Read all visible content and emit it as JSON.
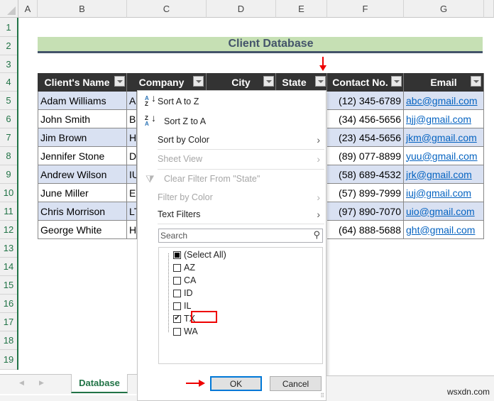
{
  "columns": [
    "A",
    "B",
    "C",
    "D",
    "E",
    "F",
    "G"
  ],
  "rows": [
    "1",
    "2",
    "3",
    "4",
    "5",
    "6",
    "7",
    "8",
    "9",
    "10",
    "11",
    "12",
    "13",
    "14",
    "15",
    "16",
    "17",
    "18",
    "19"
  ],
  "title": "Client Database",
  "table": {
    "headers": [
      "Client's Name",
      "Company",
      "City",
      "State",
      "Contact No.",
      "Email"
    ],
    "rows": [
      {
        "name": "Adam Williams",
        "company": "Al",
        "contact": "(12) 345-6789",
        "email": "abc@gmail.com"
      },
      {
        "name": "John Smith",
        "company": "Bl",
        "contact": "(34) 456-5656",
        "email": "hjj@gmail.com"
      },
      {
        "name": "Jim Brown",
        "company": "H.",
        "contact": "(23) 454-5656",
        "email": "jkm@gmail.com"
      },
      {
        "name": "Jennifer Stone",
        "company": "Do",
        "contact": "(89) 077-8899",
        "email": "yuu@gmail.com"
      },
      {
        "name": "Andrew Wilson",
        "company": "IU",
        "contact": "(58) 689-4532",
        "email": "jrk@gmail.com"
      },
      {
        "name": "June Miller",
        "company": "EF",
        "contact": "(57) 899-7999",
        "email": "iuj@gmail.com"
      },
      {
        "name": "Chris Morrison",
        "company": "LT",
        "contact": "(97) 890-7070",
        "email": "uio@gmail.com"
      },
      {
        "name": "George White",
        "company": "HI",
        "contact": "(64) 888-5688",
        "email": "ght@gmail.com"
      }
    ]
  },
  "filter_menu": {
    "sort_az": "Sort A to Z",
    "sort_za": "Sort Z to A",
    "sort_by_color": "Sort by Color",
    "sheet_view": "Sheet View",
    "clear_filter": "Clear Filter From \"State\"",
    "filter_by_color": "Filter by Color",
    "text_filters": "Text Filters",
    "search_placeholder": "Search",
    "items": [
      {
        "label": "(Select All)",
        "state": "partial"
      },
      {
        "label": "AZ",
        "state": "unchecked"
      },
      {
        "label": "CA",
        "state": "unchecked"
      },
      {
        "label": "ID",
        "state": "unchecked"
      },
      {
        "label": "IL",
        "state": "unchecked"
      },
      {
        "label": "TX",
        "state": "checked"
      },
      {
        "label": "WA",
        "state": "unchecked"
      }
    ],
    "ok": "OK",
    "cancel": "Cancel"
  },
  "sheet_tab": "Database",
  "watermark": "wsxdn.com",
  "colors": {
    "title_fill": "#c6e0b4",
    "header_fill": "#333333",
    "band_fill": "#d9e1f2",
    "excel_green": "#217346",
    "annotation_red": "#e00000",
    "link": "#0563c1"
  }
}
